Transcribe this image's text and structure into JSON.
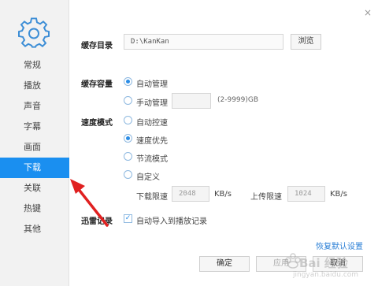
{
  "sidebar": {
    "items": [
      {
        "label": "常规"
      },
      {
        "label": "播放"
      },
      {
        "label": "声音"
      },
      {
        "label": "字幕"
      },
      {
        "label": "画面"
      },
      {
        "label": "下载"
      },
      {
        "label": "关联"
      },
      {
        "label": "热键"
      },
      {
        "label": "其他"
      }
    ],
    "active_index": 5
  },
  "close_label": "×",
  "cache_dir": {
    "label": "缓存目录",
    "value": "D:\\KanKan",
    "browse_label": "浏览"
  },
  "cache_size": {
    "label": "缓存容量",
    "auto_label": "自动管理",
    "manual_label": "手动管理",
    "manual_value": "",
    "range_hint": "(2-9999)GB",
    "selected": "auto"
  },
  "speed_mode": {
    "label": "速度模式",
    "options": [
      {
        "label": "自动控速",
        "checked": false
      },
      {
        "label": "速度优先",
        "checked": true
      },
      {
        "label": "节流模式",
        "checked": false
      },
      {
        "label": "自定义",
        "checked": false
      }
    ],
    "download_limit_label": "下载限速",
    "download_limit_value": "2048",
    "upload_limit_label": "上传限速",
    "upload_limit_value": "1024",
    "unit": "KB/s"
  },
  "thunder_record": {
    "label": "迅雷记录",
    "checkbox_label": "自动导入到播放记录",
    "checked": true
  },
  "restore_defaults_label": "恢复默认设置",
  "buttons": {
    "ok": "确定",
    "apply": "应用",
    "cancel": "取消"
  },
  "watermark": {
    "main": "Bai 经验",
    "sub": "jingyan.baidu.com"
  },
  "colors": {
    "accent": "#1a8ff0",
    "arrow": "#e02020"
  },
  "icons": {
    "logo": "gear-icon",
    "close": "close-icon",
    "annotation": "red-arrow"
  }
}
